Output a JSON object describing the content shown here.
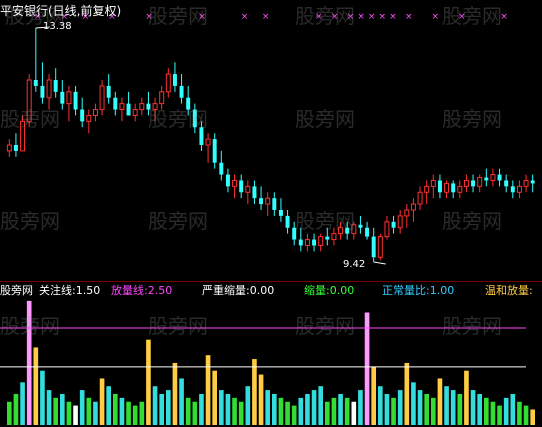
{
  "header": {
    "title": "平安银行(日线,前复权)"
  },
  "price_panel": {
    "high_label": "13.38",
    "low_label": "9.42",
    "marker_symbol": "×"
  },
  "indicator_bar": {
    "brand": "股旁网",
    "items": [
      {
        "label": "关注线:",
        "value": "1.50",
        "color": "#ffffff"
      },
      {
        "label": "放量线:",
        "value": "2.50",
        "color": "#ff44ff"
      },
      {
        "label": "严重缩量:",
        "value": "0.00",
        "color": "#ffffff"
      },
      {
        "label": "缩量:",
        "value": "0.00",
        "color": "#33ff33"
      },
      {
        "label": "正常量比:",
        "value": "1.00",
        "color": "#33ccff"
      },
      {
        "label": "温和放量:",
        "value": "",
        "color": "#ffcc44"
      }
    ]
  },
  "watermark": {
    "text": "股旁网"
  },
  "colors": {
    "up": "#ff3030",
    "down": "#33ffff",
    "marker": "#ff55ff",
    "line_pink": "#ff44ff",
    "line_white": "#ffffff",
    "vol_pink": "#ff99ff",
    "vol_yellow": "#ffcc44",
    "vol_green": "#33dd33",
    "vol_cyan": "#33dddd",
    "vol_white": "#ffffff"
  },
  "chart_data": {
    "type": "candlestick",
    "price_high": 13.38,
    "price_low": 9.42,
    "candles": [
      [
        11.3,
        11.5,
        11.2,
        11.4
      ],
      [
        11.4,
        11.6,
        11.2,
        11.3
      ],
      [
        11.3,
        11.9,
        11.3,
        11.8
      ],
      [
        11.8,
        12.6,
        11.7,
        12.5
      ],
      [
        12.5,
        13.38,
        12.3,
        12.4
      ],
      [
        12.4,
        12.8,
        12.1,
        12.2
      ],
      [
        12.2,
        12.6,
        12.0,
        12.5
      ],
      [
        12.5,
        12.7,
        12.2,
        12.3
      ],
      [
        12.3,
        12.5,
        12.0,
        12.1
      ],
      [
        12.1,
        12.4,
        11.8,
        12.3
      ],
      [
        12.3,
        12.4,
        11.9,
        12.0
      ],
      [
        12.0,
        12.2,
        11.7,
        11.8
      ],
      [
        11.8,
        12.0,
        11.6,
        11.9
      ],
      [
        11.9,
        12.1,
        11.8,
        12.0
      ],
      [
        12.0,
        12.5,
        11.9,
        12.4
      ],
      [
        12.4,
        12.6,
        12.1,
        12.2
      ],
      [
        12.2,
        12.3,
        11.9,
        12.0
      ],
      [
        12.0,
        12.2,
        11.8,
        12.1
      ],
      [
        12.1,
        12.3,
        11.9,
        11.9
      ],
      [
        11.9,
        12.1,
        11.8,
        12.0
      ],
      [
        12.0,
        12.2,
        11.9,
        12.1
      ],
      [
        12.1,
        12.3,
        11.9,
        12.0
      ],
      [
        12.0,
        12.2,
        11.8,
        12.1
      ],
      [
        12.1,
        12.4,
        12.0,
        12.3
      ],
      [
        12.3,
        12.7,
        12.2,
        12.6
      ],
      [
        12.6,
        12.8,
        12.3,
        12.4
      ],
      [
        12.4,
        12.6,
        12.1,
        12.2
      ],
      [
        12.2,
        12.4,
        11.9,
        12.0
      ],
      [
        12.0,
        12.1,
        11.6,
        11.7
      ],
      [
        11.7,
        11.8,
        11.3,
        11.4
      ],
      [
        11.4,
        11.6,
        11.1,
        11.5
      ],
      [
        11.5,
        11.6,
        11.0,
        11.1
      ],
      [
        11.1,
        11.3,
        10.8,
        10.9
      ],
      [
        10.9,
        11.0,
        10.6,
        10.7
      ],
      [
        10.7,
        10.9,
        10.5,
        10.8
      ],
      [
        10.8,
        10.9,
        10.5,
        10.6
      ],
      [
        10.6,
        10.8,
        10.4,
        10.7
      ],
      [
        10.7,
        10.8,
        10.4,
        10.5
      ],
      [
        10.5,
        10.7,
        10.3,
        10.4
      ],
      [
        10.4,
        10.6,
        10.2,
        10.5
      ],
      [
        10.5,
        10.6,
        10.2,
        10.3
      ],
      [
        10.3,
        10.5,
        10.1,
        10.2
      ],
      [
        10.2,
        10.3,
        9.9,
        10.0
      ],
      [
        10.0,
        10.1,
        9.7,
        9.8
      ],
      [
        9.8,
        10.0,
        9.6,
        9.7
      ],
      [
        9.7,
        9.9,
        9.6,
        9.8
      ],
      [
        9.8,
        9.9,
        9.6,
        9.7
      ],
      [
        9.7,
        9.9,
        9.6,
        9.85
      ],
      [
        9.85,
        10.0,
        9.7,
        9.8
      ],
      [
        9.8,
        10.0,
        9.7,
        9.9
      ],
      [
        9.9,
        10.1,
        9.8,
        10.0
      ],
      [
        10.0,
        10.1,
        9.8,
        9.9
      ],
      [
        9.9,
        10.1,
        9.8,
        10.05
      ],
      [
        10.05,
        10.2,
        9.9,
        10.0
      ],
      [
        10.0,
        10.1,
        9.8,
        9.85
      ],
      [
        9.85,
        10.0,
        9.42,
        9.5
      ],
      [
        9.5,
        9.9,
        9.45,
        9.85
      ],
      [
        9.85,
        10.2,
        9.8,
        10.1
      ],
      [
        10.1,
        10.2,
        9.9,
        10.0
      ],
      [
        10.0,
        10.3,
        9.9,
        10.2
      ],
      [
        10.2,
        10.4,
        10.0,
        10.3
      ],
      [
        10.3,
        10.5,
        10.1,
        10.4
      ],
      [
        10.4,
        10.7,
        10.3,
        10.6
      ],
      [
        10.6,
        10.8,
        10.4,
        10.7
      ],
      [
        10.7,
        10.9,
        10.5,
        10.8
      ],
      [
        10.8,
        10.9,
        10.5,
        10.6
      ],
      [
        10.6,
        10.8,
        10.5,
        10.75
      ],
      [
        10.75,
        10.8,
        10.5,
        10.6
      ],
      [
        10.6,
        10.8,
        10.5,
        10.7
      ],
      [
        10.7,
        10.9,
        10.6,
        10.8
      ],
      [
        10.8,
        10.9,
        10.6,
        10.7
      ],
      [
        10.7,
        10.9,
        10.6,
        10.85
      ],
      [
        10.85,
        11.0,
        10.7,
        10.8
      ],
      [
        10.8,
        11.0,
        10.7,
        10.9
      ],
      [
        10.9,
        11.0,
        10.7,
        10.8
      ],
      [
        10.8,
        10.9,
        10.6,
        10.7
      ],
      [
        10.7,
        10.8,
        10.5,
        10.6
      ],
      [
        10.6,
        10.8,
        10.5,
        10.7
      ],
      [
        10.7,
        10.9,
        10.6,
        10.8
      ],
      [
        10.8,
        10.9,
        10.6,
        10.75
      ]
    ],
    "markers_x": [
      0.06,
      0.11,
      0.15,
      0.2,
      0.27,
      0.37,
      0.45,
      0.49,
      0.59,
      0.62,
      0.65,
      0.67,
      0.69,
      0.71,
      0.73,
      0.76,
      0.81,
      0.86,
      0.94
    ],
    "volume": {
      "focus_line": 1.5,
      "heavy_line": 2.5,
      "ratios": [
        0.6,
        0.8,
        1.1,
        3.2,
        2.0,
        1.4,
        0.9,
        0.7,
        0.8,
        0.6,
        0.5,
        0.9,
        0.7,
        0.6,
        1.2,
        1.0,
        0.8,
        0.7,
        0.6,
        0.5,
        0.6,
        2.2,
        1.0,
        0.8,
        0.9,
        1.6,
        1.2,
        0.7,
        0.6,
        0.8,
        1.8,
        1.4,
        0.9,
        0.8,
        0.7,
        0.6,
        1.0,
        1.7,
        1.3,
        0.9,
        0.8,
        0.7,
        0.6,
        0.5,
        0.7,
        0.8,
        0.9,
        1.0,
        0.6,
        0.7,
        0.8,
        0.7,
        0.6,
        0.9,
        2.9,
        1.5,
        1.0,
        0.8,
        0.7,
        0.9,
        1.6,
        1.1,
        0.9,
        0.8,
        0.7,
        1.2,
        1.0,
        0.9,
        0.8,
        1.4,
        0.9,
        0.8,
        0.7,
        0.6,
        0.5,
        0.7,
        0.8,
        0.6,
        0.5,
        0.4
      ],
      "kinds": [
        "g",
        "g",
        "c",
        "p",
        "y",
        "c",
        "c",
        "g",
        "c",
        "g",
        "w",
        "c",
        "g",
        "c",
        "y",
        "c",
        "g",
        "c",
        "g",
        "g",
        "g",
        "y",
        "c",
        "c",
        "c",
        "y",
        "c",
        "g",
        "g",
        "c",
        "y",
        "y",
        "c",
        "c",
        "g",
        "g",
        "c",
        "y",
        "y",
        "c",
        "c",
        "g",
        "g",
        "g",
        "c",
        "c",
        "c",
        "c",
        "g",
        "g",
        "c",
        "g",
        "w",
        "c",
        "p",
        "y",
        "c",
        "c",
        "g",
        "c",
        "y",
        "c",
        "c",
        "g",
        "g",
        "y",
        "c",
        "c",
        "g",
        "y",
        "c",
        "c",
        "g",
        "g",
        "g",
        "c",
        "c",
        "g",
        "g",
        "y"
      ]
    }
  }
}
